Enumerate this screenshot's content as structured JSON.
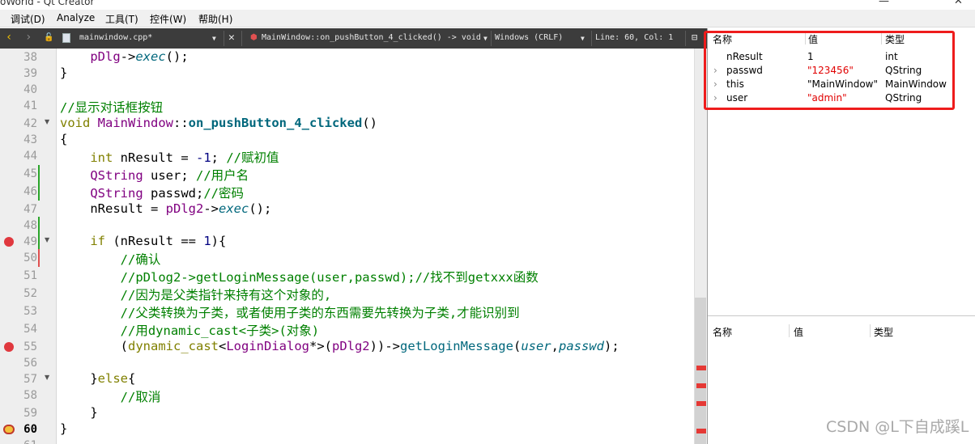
{
  "window": {
    "title": "oWorld - Qt Creator"
  },
  "menubar": [
    {
      "label": "调试(D)"
    },
    {
      "label": "Analyze"
    },
    {
      "label": "工具(T)"
    },
    {
      "label": "控件(W)"
    },
    {
      "label": "帮助(H)"
    }
  ],
  "toolbar": {
    "file_name": "mainwindow.cpp*",
    "function_sig": "MainWindow::on_pushButton_4_clicked() -> void",
    "line_ending": "Windows (CRLF)",
    "position": "Line: 60, Col: 1"
  },
  "editor": {
    "current_line": 60,
    "lines": [
      {
        "num": "38",
        "text": "    pDlg->exec();"
      },
      {
        "num": "39",
        "text": "}"
      },
      {
        "num": "40",
        "text": ""
      },
      {
        "num": "41",
        "text": "//显示对话框按钮"
      },
      {
        "num": "42",
        "text": "void MainWindow::on_pushButton_4_clicked()"
      },
      {
        "num": "43",
        "text": "{"
      },
      {
        "num": "44",
        "text": "    int nResult = -1; //赋初值"
      },
      {
        "num": "45",
        "text": "    QString user; //用户名"
      },
      {
        "num": "46",
        "text": "    QString passwd;//密码"
      },
      {
        "num": "47",
        "text": "    nResult = pDlg2->exec();"
      },
      {
        "num": "48",
        "text": ""
      },
      {
        "num": "49",
        "text": "    if (nResult == 1){"
      },
      {
        "num": "50",
        "text": "        //确认"
      },
      {
        "num": "51",
        "text": "        //pDlog2->getLoginMessage(user,passwd);//找不到getxxx函数"
      },
      {
        "num": "52",
        "text": "        //因为是父类指针来持有这个对象的,"
      },
      {
        "num": "53",
        "text": "        //父类转换为子类，或者使用子类的东西需要先转换为子类,才能识别到"
      },
      {
        "num": "54",
        "text": "        //用dynamic_cast<子类>(对象)"
      },
      {
        "num": "55",
        "text": "        (dynamic_cast<LoginDialog*>(pDlg2))->getLoginMessage(user,passwd);"
      },
      {
        "num": "56",
        "text": ""
      },
      {
        "num": "57",
        "text": "    }else{"
      },
      {
        "num": "58",
        "text": "        //取消"
      },
      {
        "num": "59",
        "text": "    }"
      },
      {
        "num": "60",
        "text": "}"
      },
      {
        "num": "61",
        "text": ""
      }
    ]
  },
  "locals": {
    "headers": {
      "name": "名称",
      "value": "值",
      "type": "类型"
    },
    "rows": [
      {
        "name": "nResult",
        "value": "1",
        "type": "int",
        "expandable": false,
        "changed": false
      },
      {
        "name": "passwd",
        "value": "\"123456\"",
        "type": "QString",
        "expandable": true,
        "changed": true
      },
      {
        "name": "this",
        "value": "\"MainWindow\"",
        "type": "MainWindow",
        "expandable": true,
        "changed": false
      },
      {
        "name": "user",
        "value": "\"admin\"",
        "type": "QString",
        "expandable": true,
        "changed": true
      }
    ]
  },
  "expressions": {
    "headers": {
      "name": "名称",
      "value": "值",
      "type": "类型"
    }
  },
  "watermark": "CSDN @L下自成蹊L",
  "colors": {
    "comment": "#008000",
    "keyword": "#808000",
    "function": "#00677c",
    "type": "#800080",
    "breakpoint": "#e0383e",
    "highlight_box": "#ee1c1c"
  }
}
